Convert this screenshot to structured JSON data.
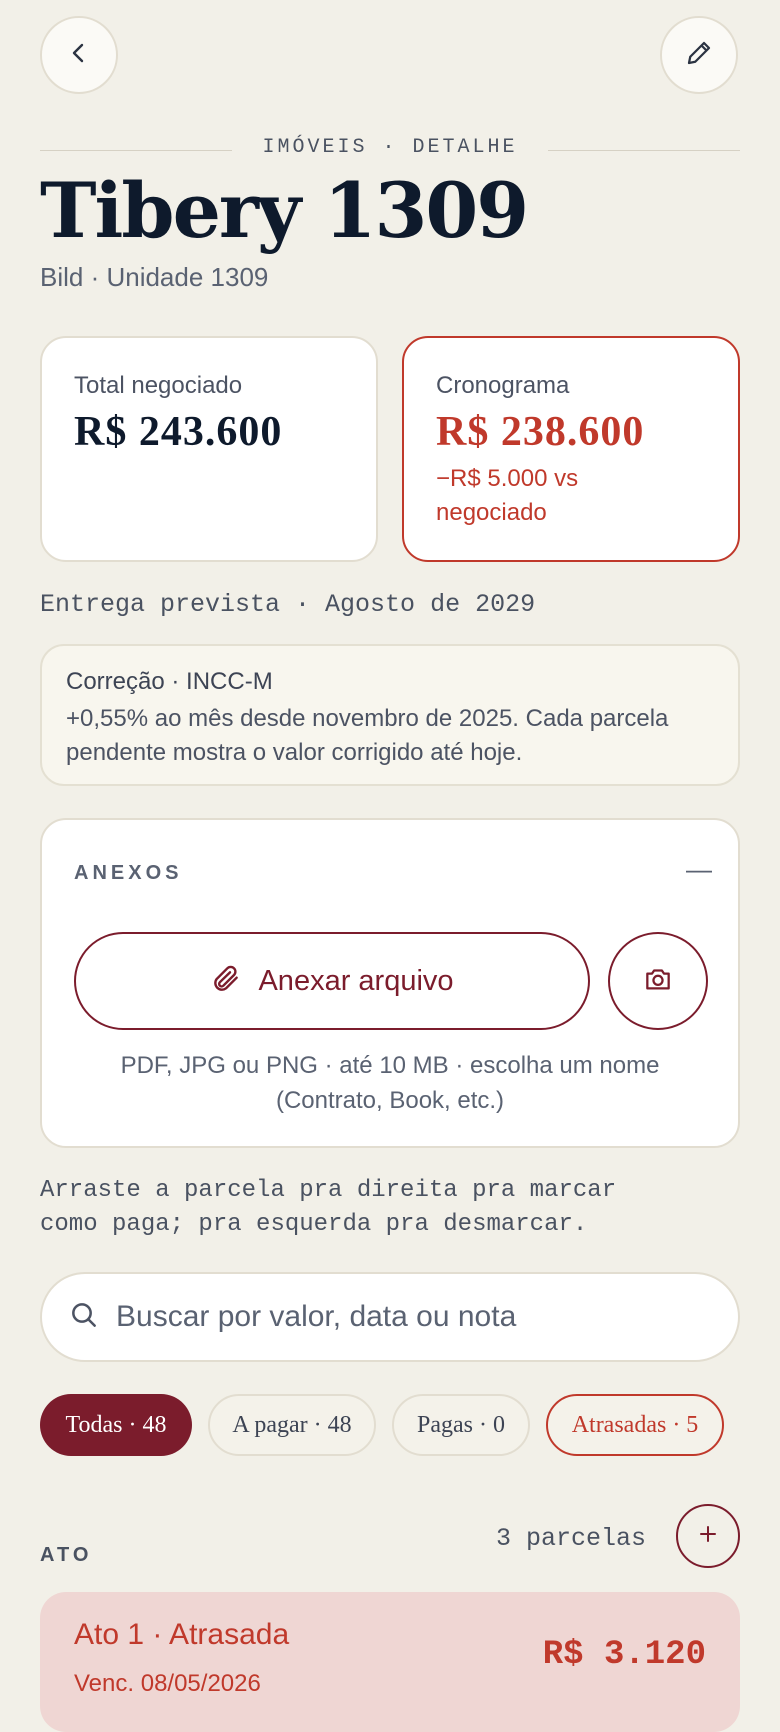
{
  "header": {
    "kicker": "IMÓVEIS · DETALHE",
    "title": "Tibery 1309",
    "subtitle": "Bild · Unidade 1309",
    "back_icon": "chevron-left-icon",
    "edit_icon": "pencil-icon"
  },
  "totals": {
    "negotiated_label": "Total negociado",
    "negotiated_value": "R$ 243.600",
    "schedule_label": "Cronograma",
    "schedule_value": "R$ 238.600",
    "schedule_diff_line1": "−R$ 5.000 vs",
    "schedule_diff_line2": "negociado"
  },
  "delivery": "Entrega prevista · Agosto de 2029",
  "correction": {
    "title": "Correção · INCC-M",
    "line1": "+0,55% ao mês desde novembro de 2025. Cada parcela",
    "line2": "pendente mostra o valor corrigido até hoje."
  },
  "attachments": {
    "heading": "ANEXOS",
    "collapse_symbol": "—",
    "attach_label": "Anexar arquivo",
    "hint_line1": "PDF, JPG ou PNG · até 10 MB · escolha um nome",
    "hint_line2": "(Contrato, Book, etc.)",
    "attach_icon": "paperclip-icon",
    "camera_icon": "camera-icon"
  },
  "swipe_hint": {
    "line1": "Arraste a parcela pra direita pra marcar",
    "line2": "como paga; pra esquerda pra desmarcar."
  },
  "search": {
    "placeholder": "Buscar por valor, data ou nota"
  },
  "filters": [
    {
      "label": "Todas · 48",
      "active": true
    },
    {
      "label": "A pagar · 48",
      "active": false
    },
    {
      "label": "Pagas · 0",
      "active": false
    },
    {
      "label": "Atrasadas · 5",
      "active": false
    }
  ],
  "section": {
    "title": "ATO",
    "count": "3 parcelas",
    "add_icon": "plus-icon"
  },
  "installment": {
    "title": "Ato 1 · Atrasada",
    "due": "Venc. 08/05/2026",
    "amount": "R$ 3.120"
  },
  "colors": {
    "background": "#f2f0e8",
    "accent": "#7b1c2c",
    "alert": "#c0392b",
    "ink": "#0e1a2c"
  }
}
